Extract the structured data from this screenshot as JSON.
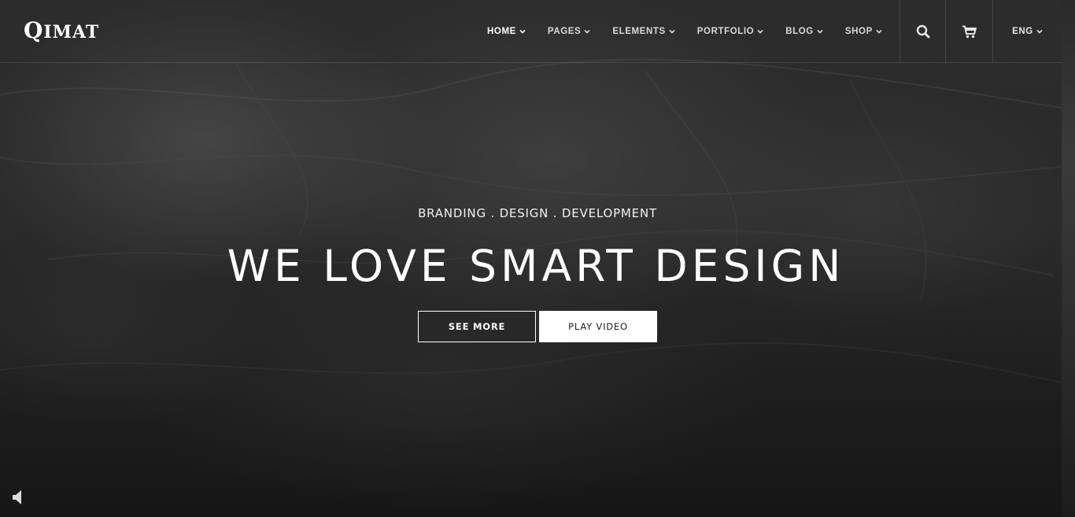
{
  "header": {
    "logo": {
      "first": "Q",
      "rest": "IMAT"
    },
    "nav": [
      {
        "label": "HOME",
        "active": true
      },
      {
        "label": "PAGES",
        "active": false
      },
      {
        "label": "ELEMENTS",
        "active": false
      },
      {
        "label": "PORTFOLIO",
        "active": false
      },
      {
        "label": "BLOG",
        "active": false
      },
      {
        "label": "SHOP",
        "active": false
      }
    ],
    "icons": {
      "search": "search-icon",
      "cart": "cart-icon"
    },
    "language": "ENG"
  },
  "hero": {
    "tagline": "BRANDING . DESIGN . DEVELOPMENT",
    "headline": "WE LOVE SMART DESIGN",
    "buttons": {
      "see_more": "SEE MORE",
      "play_video": "PLAY VIDEO"
    },
    "sound_icon": "speaker-icon"
  },
  "colors": {
    "text": "#ffffff",
    "background": "#2a2a2a",
    "button_solid_bg": "#ffffff",
    "button_solid_text": "#222222"
  }
}
